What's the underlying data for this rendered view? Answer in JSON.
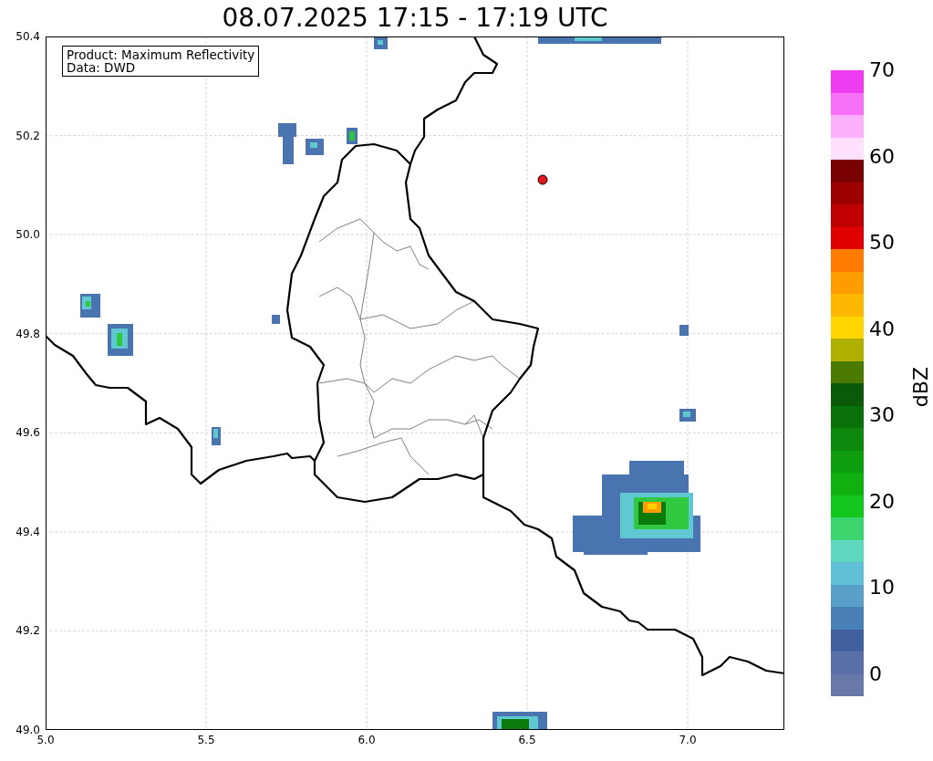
{
  "title": "08.07.2025 17:15 - 17:19 UTC",
  "map": {
    "legend": [
      "Product: Maximum Reflectivity",
      "Data: DWD"
    ],
    "xticks": [
      "5.0",
      "5.5",
      "6.0",
      "6.5",
      "7.0"
    ],
    "yticks": [
      "50.4",
      "50.2",
      "50.0",
      "49.8",
      "49.6",
      "49.4",
      "49.2",
      "49.0"
    ],
    "marker": {
      "color": "#e8141c"
    }
  },
  "colorbar": {
    "label": "dBZ",
    "ticks": [
      "70",
      "60",
      "50",
      "40",
      "30",
      "20",
      "10",
      "0"
    ],
    "bands": [
      {
        "color": "#f03cf0"
      },
      {
        "color": "#f870f8"
      },
      {
        "color": "#fbb0fb"
      },
      {
        "color": "#ffe0ff"
      },
      {
        "color": "#780000"
      },
      {
        "color": "#9c0000"
      },
      {
        "color": "#c00000"
      },
      {
        "color": "#e00000"
      },
      {
        "color": "#ff7c00"
      },
      {
        "color": "#ff9c00"
      },
      {
        "color": "#ffb800"
      },
      {
        "color": "#ffd600"
      },
      {
        "color": "#b0b000"
      },
      {
        "color": "#4a7a00"
      },
      {
        "color": "#0a5a0a"
      },
      {
        "color": "#0a700a"
      },
      {
        "color": "#0c880c"
      },
      {
        "color": "#0e9e0e"
      },
      {
        "color": "#10b010"
      },
      {
        "color": "#12c81c"
      },
      {
        "color": "#3cd46c"
      },
      {
        "color": "#60d8c0"
      },
      {
        "color": "#60c0d8"
      },
      {
        "color": "#58a0c8"
      },
      {
        "color": "#4a80b8"
      },
      {
        "color": "#4060a0"
      },
      {
        "color": "#5a6ea8"
      },
      {
        "color": "#6878a8"
      }
    ]
  }
}
